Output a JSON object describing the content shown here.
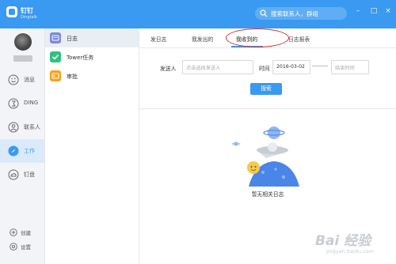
{
  "app": {
    "name": "钉钉",
    "subtitle": "Dingtalk"
  },
  "search": {
    "placeholder": "搜索联系人，群组"
  },
  "sidebar": {
    "items": [
      {
        "label": "消息",
        "icon": "smile-icon"
      },
      {
        "label": "DING",
        "icon": "ding-icon"
      },
      {
        "label": "联系人",
        "icon": "contacts-icon"
      },
      {
        "label": "工作",
        "icon": "work-icon",
        "active": true
      },
      {
        "label": "钉盘",
        "icon": "cloud-drive-icon"
      }
    ],
    "bottom": [
      {
        "label": "创建",
        "icon": "plus-icon"
      },
      {
        "label": "设置",
        "icon": "gear-icon"
      }
    ]
  },
  "apps": [
    {
      "label": "日志",
      "color": "#7b8bd6",
      "active": true
    },
    {
      "label": "Tower任务",
      "color": "#2fc27c"
    },
    {
      "label": "审批",
      "color": "#f6a31f"
    }
  ],
  "tabs": [
    {
      "label": "发日志"
    },
    {
      "label": "我发出的"
    },
    {
      "label": "我收到的",
      "active": true
    },
    {
      "label": "日志报表"
    }
  ],
  "filter": {
    "sender_label": "发送人",
    "sender_placeholder": "点击选择发送人",
    "time_label": "时间",
    "start_date": "2016-03-02",
    "end_placeholder": "结束时间",
    "search_button": "搜索"
  },
  "empty_text": "暂无相关日志",
  "watermark": {
    "brand": "Bai 经验",
    "url": "jingyan.baidu.com"
  },
  "colors": {
    "primary": "#3a99f0",
    "highlight_circle": "#d9302c"
  }
}
